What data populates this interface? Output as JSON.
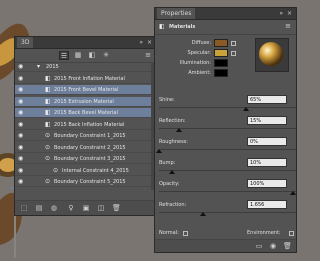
{
  "left_panel": {
    "tab": "3D",
    "menu_glyph": "≡",
    "collapse_glyph": "» ×",
    "layers": [
      {
        "label": "2015",
        "highlight": false,
        "indent": 1,
        "icon": "folder"
      },
      {
        "label": "2015 Front Inflation Material",
        "highlight": false,
        "indent": 2,
        "icon": "material"
      },
      {
        "label": "2015 Front Bevel Material",
        "highlight": true,
        "indent": 2,
        "icon": "material"
      },
      {
        "label": "2015 Extrusion Material",
        "highlight": true,
        "indent": 2,
        "icon": "material"
      },
      {
        "label": "2015 Back Bevel Material",
        "highlight": true,
        "indent": 2,
        "icon": "material"
      },
      {
        "label": "2015 Back Inflation Material",
        "highlight": false,
        "indent": 2,
        "icon": "material"
      },
      {
        "label": "Boundary Constraint 1_2015",
        "highlight": false,
        "indent": 2,
        "icon": "constraint"
      },
      {
        "label": "Boundary Constraint 2_2015",
        "highlight": false,
        "indent": 2,
        "icon": "constraint"
      },
      {
        "label": "Boundary Constraint 3_2015",
        "highlight": false,
        "indent": 2,
        "icon": "constraint"
      },
      {
        "label": "Internal Constraint 4_2015",
        "highlight": false,
        "indent": 3,
        "icon": "constraint"
      },
      {
        "label": "Boundary Constraint 5_2015",
        "highlight": false,
        "indent": 2,
        "icon": "constraint"
      }
    ]
  },
  "right_panel": {
    "tab": "Properties",
    "title": "Materials",
    "menu_glyph": "≡",
    "collapse_glyph": "» ×",
    "swatch_labels": [
      "Diffuse:",
      "Specular:",
      "Illumination:",
      "Ambient:"
    ],
    "swatch_colors": [
      "#8a5a24",
      "#c9a23a",
      "#000000",
      "#000000"
    ],
    "sliders": [
      {
        "label": "Shine:",
        "value": "65%",
        "position": 0.65
      },
      {
        "label": "Reflection:",
        "value": "15%",
        "position": 0.15
      },
      {
        "label": "Roughness:",
        "value": "0%",
        "position": 0.0
      },
      {
        "label": "Bump:",
        "value": "10%",
        "position": 0.1
      },
      {
        "label": "Opacity:",
        "value": "100%",
        "position": 1.0
      },
      {
        "label": "Refraction:",
        "value": "1.656",
        "position": 0.33
      }
    ],
    "normal_label": "Normal:",
    "environment_label": "Environment:"
  },
  "colors": {
    "panel_bg": "#535353",
    "highlight_row": "#6e7f9b"
  }
}
